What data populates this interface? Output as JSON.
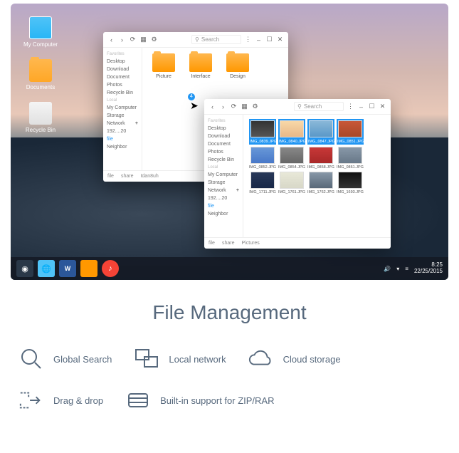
{
  "desktop": {
    "icons": [
      {
        "label": "My Computer"
      },
      {
        "label": "Documents"
      },
      {
        "label": "Recycle Bin"
      }
    ]
  },
  "window1": {
    "search_placeholder": "Search",
    "sidebar": {
      "groups": [
        {
          "label": "Favorites",
          "items": [
            "Desktop",
            "Download",
            "Document",
            "Photos",
            "Recycle Bin"
          ]
        },
        {
          "label": "Local",
          "items": [
            "My Computer",
            "Storage"
          ]
        },
        {
          "label": "Network",
          "ip": "192....20",
          "items": [
            "file",
            "Neighbor"
          ]
        }
      ]
    },
    "folders": [
      "Picture",
      "Interface",
      "Design"
    ],
    "status": [
      "file",
      "share",
      "Idan8uh"
    ],
    "cursor_badge": "4"
  },
  "window2": {
    "search_placeholder": "Search",
    "sidebar": {
      "groups": [
        {
          "label": "Favorites",
          "items": [
            "Desktop",
            "Download",
            "Document",
            "Photos",
            "Recycle Bin"
          ]
        },
        {
          "label": "Local",
          "items": [
            "My Computer",
            "Storage"
          ]
        },
        {
          "label": "Network",
          "ip": "192....20",
          "items": [
            "file",
            "Neighbor"
          ]
        }
      ]
    },
    "images": [
      {
        "name": "IMG_0839.JPG",
        "selected": true
      },
      {
        "name": "IMG_0840.JPG",
        "selected": true
      },
      {
        "name": "IMG_0847.JPG",
        "selected": true
      },
      {
        "name": "IMG_0851.JPG",
        "selected": true
      },
      {
        "name": "IMG_0852.JPG",
        "selected": false
      },
      {
        "name": "IMG_0854.JPG",
        "selected": false
      },
      {
        "name": "IMG_0858.JPG",
        "selected": false
      },
      {
        "name": "IMG_0861.JPG",
        "selected": false
      },
      {
        "name": "IMG_1711.JPG",
        "selected": false
      },
      {
        "name": "IMG_1761.JPG",
        "selected": false
      },
      {
        "name": "IMG_1762.JPG",
        "selected": false
      },
      {
        "name": "IMG_1693.JPG",
        "selected": false
      }
    ],
    "status": [
      "file",
      "share",
      "Pictures"
    ]
  },
  "taskbar": {
    "word_label": "W",
    "time": "8:25",
    "date": "22/25/2015"
  },
  "marketing": {
    "title": "File Management",
    "features": [
      "Global Search",
      "Local network",
      "Cloud storage",
      "Drag & drop",
      "Built-in support for ZIP/RAR"
    ]
  }
}
